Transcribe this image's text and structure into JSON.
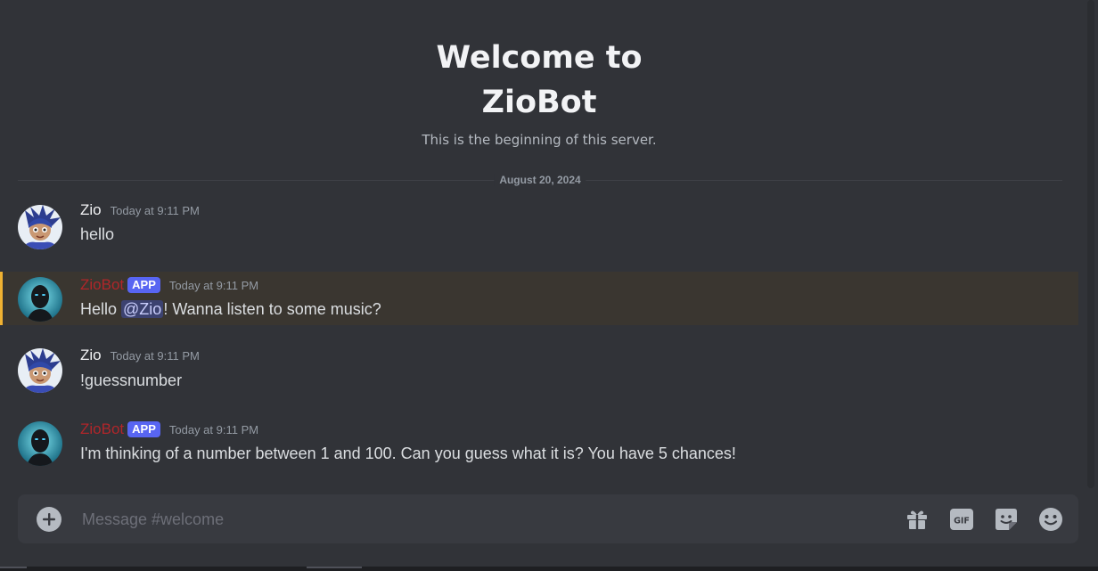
{
  "welcome": {
    "title_line1": "Welcome to",
    "title_line2": "ZioBot",
    "subtitle": "This is the beginning of this server."
  },
  "divider": {
    "date": "August 20, 2024"
  },
  "messages": [
    {
      "author": "Zio",
      "bot": false,
      "timestamp": "Today at 9:11 PM",
      "text": "hello"
    },
    {
      "author": "ZioBot",
      "bot": true,
      "badge": "APP",
      "timestamp": "Today at 9:11 PM",
      "text_before": "Hello ",
      "mention": "@Zio",
      "text_after": "! Wanna listen to some music?"
    },
    {
      "author": "Zio",
      "bot": false,
      "timestamp": "Today at 9:11 PM",
      "text": "!guessnumber"
    },
    {
      "author": "ZioBot",
      "bot": true,
      "badge": "APP",
      "timestamp": "Today at 9:11 PM",
      "text": "I'm thinking of a number between 1 and 100. Can you guess what it is? You have 5 chances!"
    }
  ],
  "composer": {
    "placeholder": "Message #welcome",
    "tools": [
      "gift-icon",
      "gif-icon",
      "sticker-icon",
      "emoji-icon"
    ],
    "gif_label": "GIF"
  },
  "colors": {
    "background": "#313338",
    "bot_name": "#b0262a",
    "app_badge": "#5865f2",
    "mention_highlight": "#3a3630",
    "mention_bar": "#f0b232"
  }
}
